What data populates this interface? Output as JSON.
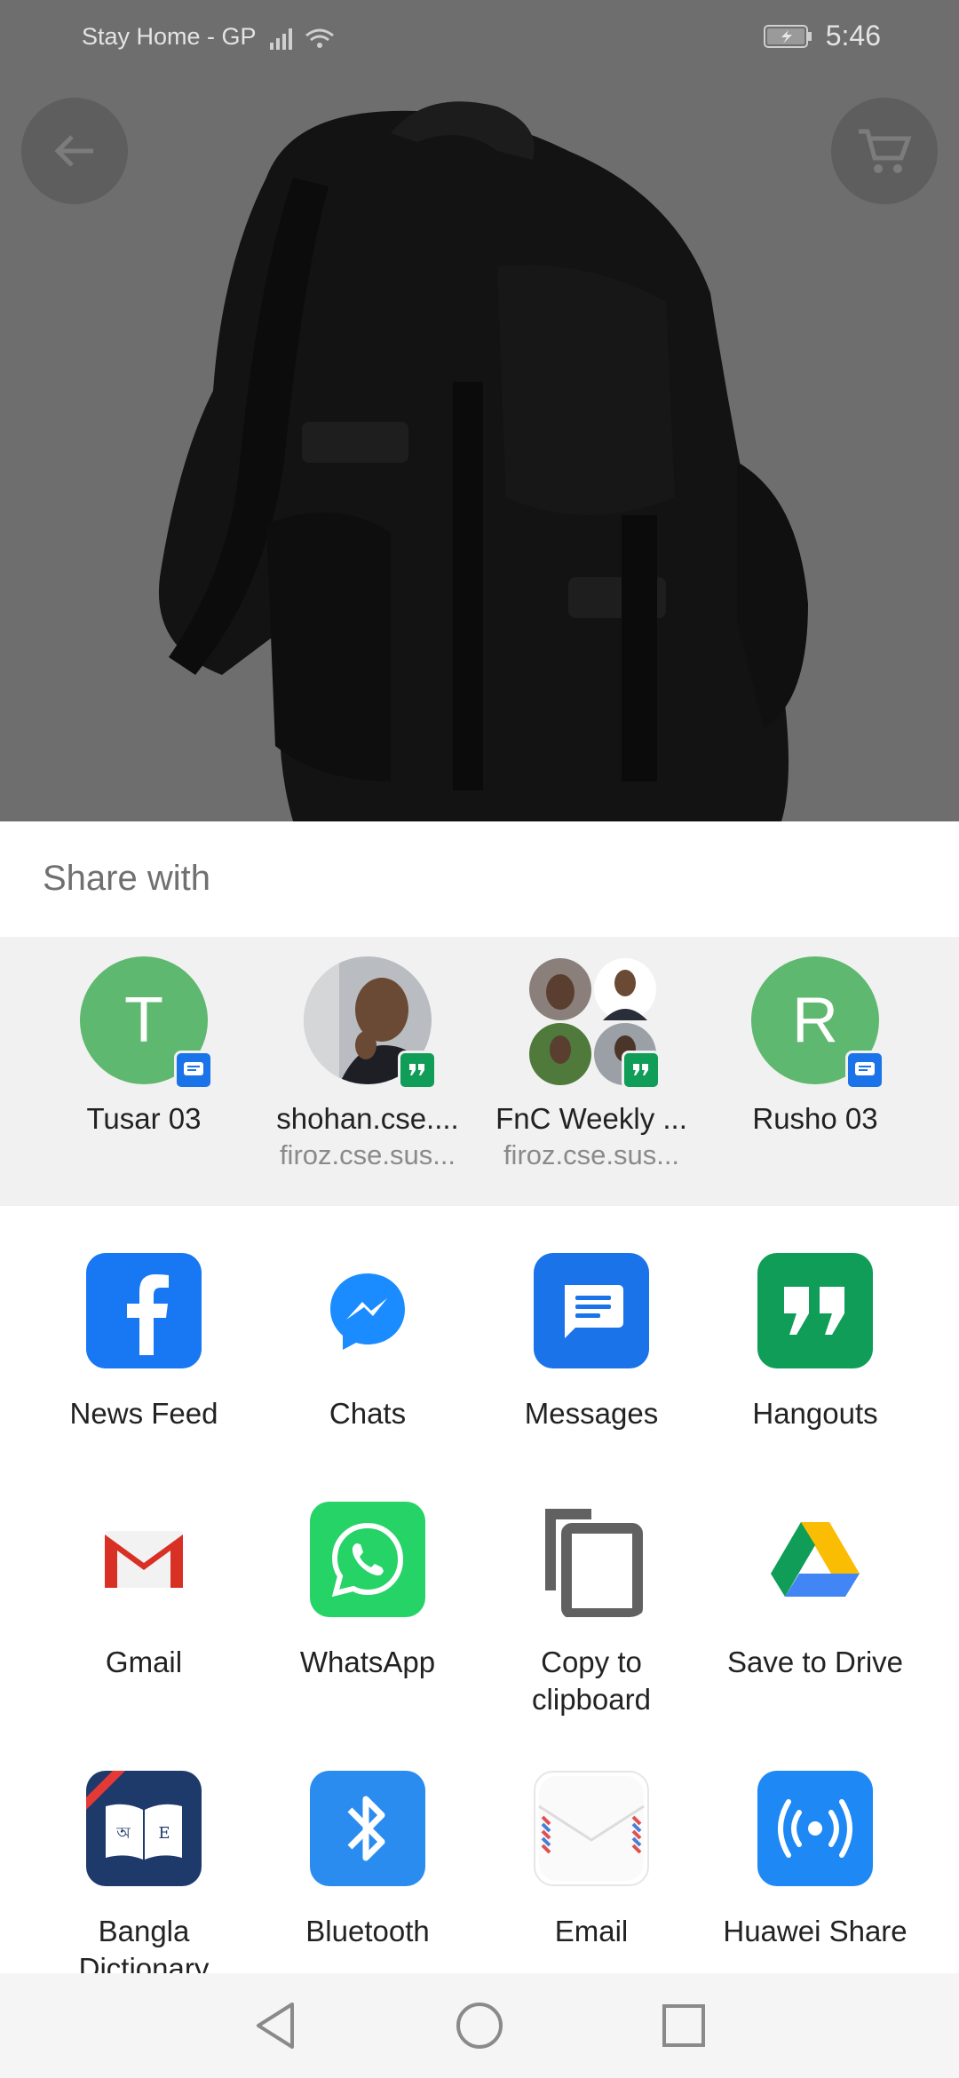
{
  "status_bar": {
    "carrier": "Stay Home - GP",
    "time": "5:46"
  },
  "share_sheet": {
    "title": "Share with",
    "direct_share": [
      {
        "name": "Tusar 03",
        "subtitle": "",
        "avatar_letter": "T",
        "badge": "messages-badge-icon"
      },
      {
        "name": "shohan.cse....",
        "subtitle": "firoz.cse.sus...",
        "avatar_letter": "",
        "badge": "hangouts-badge-icon"
      },
      {
        "name": "FnC Weekly ...",
        "subtitle": "firoz.cse.sus...",
        "avatar_letter": "",
        "badge": "hangouts-badge-icon"
      },
      {
        "name": "Rusho 03",
        "subtitle": "",
        "avatar_letter": "R",
        "badge": "messages-badge-icon"
      }
    ],
    "apps": [
      {
        "label": "News Feed",
        "icon": "facebook-icon"
      },
      {
        "label": "Chats",
        "icon": "messenger-icon"
      },
      {
        "label": "Messages",
        "icon": "messages-icon"
      },
      {
        "label": "Hangouts",
        "icon": "hangouts-icon"
      },
      {
        "label": "Gmail",
        "icon": "gmail-icon"
      },
      {
        "label": "WhatsApp",
        "icon": "whatsapp-icon"
      },
      {
        "label": "Copy to clipboard",
        "icon": "copy-icon"
      },
      {
        "label": "Save to Drive",
        "icon": "drive-icon"
      },
      {
        "label": "Bangla Dictionary",
        "icon": "bangla-dictionary-icon"
      },
      {
        "label": "Bluetooth",
        "icon": "bluetooth-icon"
      },
      {
        "label": "Email",
        "icon": "email-icon"
      },
      {
        "label": "Huawei Share",
        "icon": "huawei-share-icon"
      }
    ]
  },
  "colors": {
    "avatar_green": "#5fb86f",
    "facebook_blue": "#1877f2",
    "messages_blue": "#1a73e8",
    "hangouts_green": "#0f9d58",
    "whatsapp_green": "#25d366"
  }
}
